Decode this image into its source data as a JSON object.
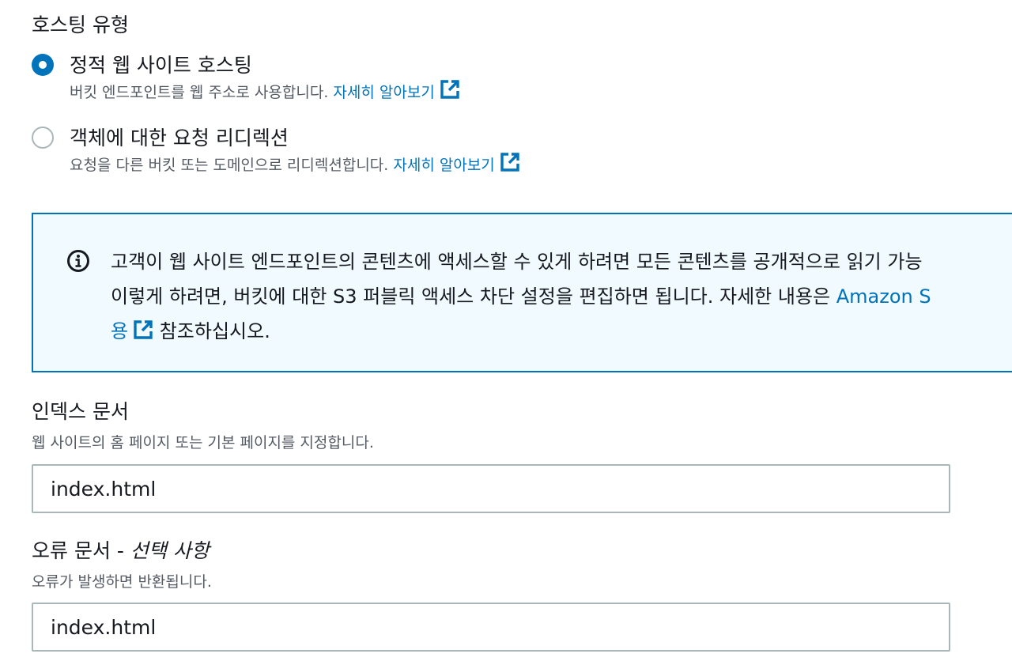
{
  "hosting_type": {
    "title": "호스팅 유형",
    "options": [
      {
        "label": "정적 웹 사이트 호스팅",
        "description": "버킷 엔드포인트를 웹 주소로 사용합니다.",
        "link": "자세히 알아보기",
        "selected": true
      },
      {
        "label": "객체에 대한 요청 리디렉션",
        "description": "요청을 다른 버킷 또는 도메인으로 리디렉션합니다.",
        "link": "자세히 알아보기",
        "selected": false
      }
    ]
  },
  "info_alert": {
    "line1": "고객이 웹 사이트 엔드포인트의 콘텐츠에 액세스할 수 있게 하려면 모든 콘텐츠를 공개적으로 읽기 가능",
    "line2_prefix": "이렇게 하려면, 버킷에 대한 S3 퍼블릭 액세스 차단 설정을 편집하면 됩니다. 자세한 내용은 ",
    "line2_link": "Amazon S",
    "line3_link": "용",
    "line3_suffix": " 참조하십시오."
  },
  "index_document": {
    "label": "인덱스 문서",
    "description": "웹 사이트의 홈 페이지 또는 기본 페이지를 지정합니다.",
    "value": "index.html"
  },
  "error_document": {
    "label": "오류 문서 - ",
    "label_optional": "선택 사항",
    "description": "오류가 발생하면 반환됩니다.",
    "value": "index.html"
  },
  "colors": {
    "link": "#0073bb",
    "radio_selected": "#0073bb",
    "info_border": "#0073bb",
    "info_background": "#f1faff",
    "input_border": "#aab7b8"
  },
  "icons": {
    "external_link": "external-link-icon",
    "info": "info-icon"
  }
}
